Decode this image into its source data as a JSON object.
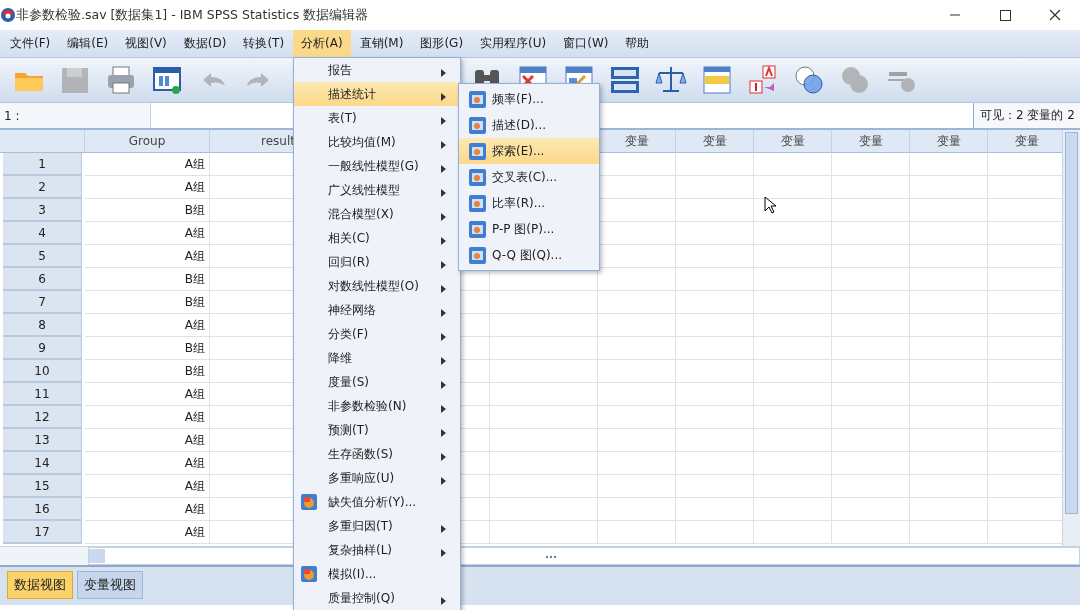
{
  "window": {
    "title": "非参数检验.sav [数据集1] - IBM SPSS Statistics 数据编辑器"
  },
  "menu_bar": [
    {
      "label": "文件(F)",
      "selected": false
    },
    {
      "label": "编辑(E)",
      "selected": false
    },
    {
      "label": "视图(V)",
      "selected": false
    },
    {
      "label": "数据(D)",
      "selected": false
    },
    {
      "label": "转换(T)",
      "selected": false
    },
    {
      "label": "分析(A)",
      "selected": true
    },
    {
      "label": "直销(M)",
      "selected": false
    },
    {
      "label": "图形(G)",
      "selected": false
    },
    {
      "label": "实用程序(U)",
      "selected": false
    },
    {
      "label": "窗口(W)",
      "selected": false
    },
    {
      "label": "帮助",
      "selected": false
    }
  ],
  "toolbar": [
    {
      "kind": "open",
      "disabled": false
    },
    {
      "kind": "save",
      "disabled": true
    },
    {
      "kind": "print",
      "disabled": false
    },
    {
      "kind": "recall",
      "disabled": false
    },
    {
      "kind": "undo",
      "disabled": true
    },
    {
      "kind": "redo",
      "disabled": true
    },
    {
      "kind": "find",
      "disabled": false
    },
    {
      "kind": "insert-cases",
      "disabled": false
    },
    {
      "kind": "insert-variable",
      "disabled": false
    },
    {
      "kind": "split",
      "disabled": false
    },
    {
      "kind": "weight",
      "disabled": false
    },
    {
      "kind": "select",
      "disabled": false
    },
    {
      "kind": "value-labels",
      "disabled": false
    },
    {
      "kind": "variable-sets",
      "disabled": false
    },
    {
      "kind": "show-sets",
      "disabled": true
    },
    {
      "kind": "spell",
      "disabled": true
    }
  ],
  "cell_ref": {
    "label": "1 :"
  },
  "visible_count": "可见：2 变量的 2",
  "table": {
    "columns": [
      "Group",
      "result",
      "变量",
      "变量",
      "变量",
      "变量",
      "变量",
      "变量"
    ],
    "rows": [
      {
        "number": "1",
        "group": "A组"
      },
      {
        "number": "2",
        "group": "A组"
      },
      {
        "number": "3",
        "group": "B组"
      },
      {
        "number": "4",
        "group": "A组"
      },
      {
        "number": "5",
        "group": "A组"
      },
      {
        "number": "6",
        "group": "B组"
      },
      {
        "number": "7",
        "group": "B组"
      },
      {
        "number": "8",
        "group": "A组"
      },
      {
        "number": "9",
        "group": "B组"
      },
      {
        "number": "10",
        "group": "B组"
      },
      {
        "number": "11",
        "group": "A组"
      },
      {
        "number": "12",
        "group": "A组"
      },
      {
        "number": "13",
        "group": "A组"
      },
      {
        "number": "14",
        "group": "A组"
      },
      {
        "number": "15",
        "group": "A组"
      },
      {
        "number": "16",
        "group": "A组"
      },
      {
        "number": "17",
        "group": "A组"
      }
    ]
  },
  "analyze_menu": {
    "items": [
      {
        "label": "报告",
        "kind": "submenu",
        "selected": false
      },
      {
        "label": "描述统计",
        "kind": "submenu",
        "selected": true
      },
      {
        "label": "表(T)",
        "kind": "submenu",
        "selected": false
      },
      {
        "label": "比较均值(M)",
        "kind": "submenu",
        "selected": false
      },
      {
        "label": "一般线性模型(G)",
        "kind": "submenu",
        "selected": false
      },
      {
        "label": "广义线性模型",
        "kind": "submenu",
        "selected": false
      },
      {
        "label": "混合模型(X)",
        "kind": "submenu",
        "selected": false
      },
      {
        "label": "相关(C)",
        "kind": "submenu",
        "selected": false
      },
      {
        "label": "回归(R)",
        "kind": "submenu",
        "selected": false
      },
      {
        "label": "对数线性模型(O)",
        "kind": "submenu",
        "selected": false
      },
      {
        "label": "神经网络",
        "kind": "submenu",
        "selected": false
      },
      {
        "label": "分类(F)",
        "kind": "submenu",
        "selected": false
      },
      {
        "label": "降维",
        "kind": "submenu",
        "selected": false
      },
      {
        "label": "度量(S)",
        "kind": "submenu",
        "selected": false
      },
      {
        "label": "非参数检验(N)",
        "kind": "submenu",
        "selected": false
      },
      {
        "label": "预测(T)",
        "kind": "submenu",
        "selected": false
      },
      {
        "label": "生存函数(S)",
        "kind": "submenu",
        "selected": false
      },
      {
        "label": "多重响应(U)",
        "kind": "submenu",
        "selected": false
      },
      {
        "label": "缺失值分析(Y)...",
        "kind": "command",
        "selected": false
      },
      {
        "label": "多重归因(T)",
        "kind": "submenu",
        "selected": false
      },
      {
        "label": "复杂抽样(L)",
        "kind": "submenu",
        "selected": false
      },
      {
        "label": "模拟(I)...",
        "kind": "command",
        "selected": false
      },
      {
        "label": "质量控制(Q)",
        "kind": "submenu",
        "selected": false
      }
    ]
  },
  "descriptives_submenu": {
    "items": [
      {
        "label": "频率(F)...",
        "selected": false
      },
      {
        "label": "描述(D)...",
        "selected": false
      },
      {
        "label": "探索(E)...",
        "selected": true
      },
      {
        "label": "交叉表(C)...",
        "selected": false
      },
      {
        "label": "比率(R)...",
        "selected": false
      },
      {
        "label": "P-P 图(P)...",
        "selected": false
      },
      {
        "label": "Q-Q 图(Q)...",
        "selected": false
      }
    ]
  },
  "bottom_tabs": [
    {
      "label": "数据视图",
      "selected": true
    },
    {
      "label": "变量视图",
      "selected": false
    }
  ]
}
